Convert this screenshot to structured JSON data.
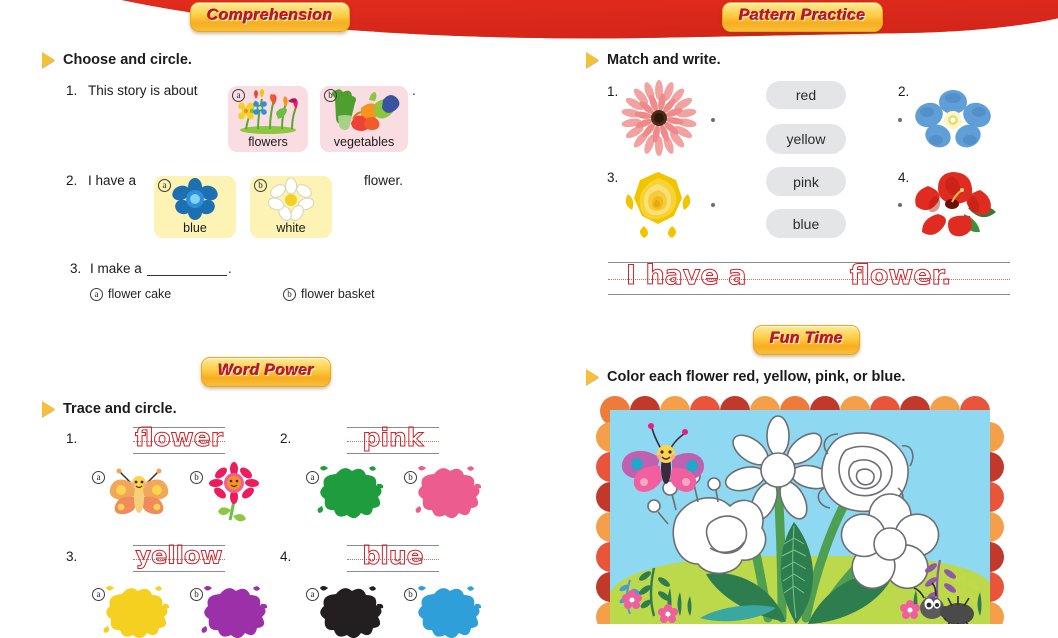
{
  "page": {
    "banner_color": "#ed3124",
    "badge_text_color": "#c3172b",
    "trace_color": "#cf2229"
  },
  "sections": {
    "comprehension": {
      "badge": "Comprehension",
      "instruction": "Choose and circle.",
      "q1": {
        "num": "1.",
        "text": "This story is about",
        "period": ".",
        "options": [
          {
            "mark": "a",
            "caption": "flowers",
            "art": "flowers-bunch-icon",
            "card": "pink"
          },
          {
            "mark": "b",
            "caption": "vegetables",
            "art": "vegetables-icon",
            "card": "pink"
          }
        ]
      },
      "q2": {
        "num": "2.",
        "text": "I have a",
        "tail": "flower.",
        "options": [
          {
            "mark": "a",
            "caption": "blue",
            "art": "blue-flower-icon",
            "card": "yellow"
          },
          {
            "mark": "b",
            "caption": "white",
            "art": "white-daisy-icon",
            "card": "yellow"
          }
        ]
      },
      "q3": {
        "num": "3.",
        "text": "I make a",
        "period": ".",
        "options": [
          {
            "mark": "a",
            "label": "flower cake"
          },
          {
            "mark": "b",
            "label": "flower basket"
          }
        ]
      }
    },
    "word_power": {
      "badge": "Word Power",
      "instruction": "Trace and circle.",
      "items": [
        {
          "num": "1.",
          "word": "flower",
          "options": [
            {
              "mark": "a",
              "art": "butterfly-icon"
            },
            {
              "mark": "b",
              "art": "pink-daisy-icon"
            }
          ]
        },
        {
          "num": "2.",
          "word": "pink",
          "options": [
            {
              "mark": "a",
              "art": "green-splat-icon"
            },
            {
              "mark": "b",
              "art": "pink-splat-icon"
            }
          ]
        },
        {
          "num": "3.",
          "word": "yellow",
          "options": [
            {
              "mark": "a",
              "art": "yellow-splat-icon"
            },
            {
              "mark": "b",
              "art": "purple-splat-icon"
            }
          ]
        },
        {
          "num": "4.",
          "word": "blue",
          "options": [
            {
              "mark": "a",
              "art": "black-splat-icon"
            },
            {
              "mark": "b",
              "art": "blue-splat-icon"
            }
          ]
        }
      ]
    },
    "pattern_practice": {
      "badge": "Pattern Practice",
      "instruction": "Match and write.",
      "items": [
        {
          "num": "1.",
          "art": "pink-gerbera-icon"
        },
        {
          "num": "2.",
          "art": "blue-forget-me-not-icon"
        },
        {
          "num": "3.",
          "art": "yellow-rose-icon"
        },
        {
          "num": "4.",
          "art": "red-hibiscus-icon"
        }
      ],
      "word_bank": [
        "red",
        "yellow",
        "pink",
        "blue"
      ],
      "write_line": "I have a           flower."
    },
    "fun_time": {
      "badge": "Fun Time",
      "instruction": "Color each flower red, yellow, pink, or blue.",
      "picture": {
        "name": "coloring-picture-flowers",
        "sky_color": "#8ed8f2",
        "grass_color": "#bcd84b",
        "scallop_colors": [
          "#ef7b3a",
          "#c0392b",
          "#f4a04a",
          "#e8553a",
          "#f6b46a",
          "#d1442c"
        ],
        "elements": [
          "butterfly",
          "daisy-outline",
          "rose-outline",
          "tulip-outline",
          "five-petal-outline",
          "leaves",
          "ant",
          "small-flowers"
        ]
      }
    }
  }
}
